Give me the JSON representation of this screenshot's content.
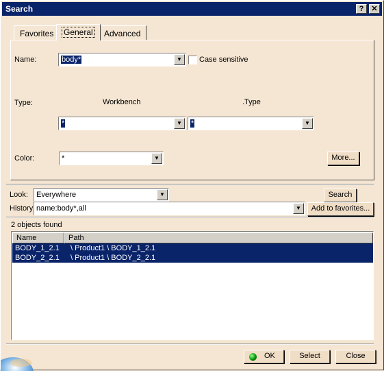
{
  "window": {
    "title": "Search"
  },
  "titlebar": {
    "help_label": "?",
    "close_label": "✕"
  },
  "tabs": [
    {
      "label": "Favorites"
    },
    {
      "label": "General"
    },
    {
      "label": "Advanced"
    }
  ],
  "general": {
    "name_label": "Name:",
    "name_value": "body*",
    "case_sensitive_label": "Case sensitive",
    "case_sensitive_checked": false,
    "type_label": "Type:",
    "workbench_label": "Workbench",
    "dottype_label": ".Type",
    "workbench_value": "*",
    "type_value": "*",
    "color_label": "Color:",
    "color_value": "*",
    "more_button": "More..."
  },
  "search": {
    "look_label": "Look:",
    "look_value": "Everywhere",
    "search_button": "Search",
    "history_label": "History:",
    "history_value": "name:body*,all",
    "add_favorites_button": "Add to favorites..."
  },
  "results": {
    "count_text": "2 objects found",
    "columns": [
      "Name",
      "Path"
    ],
    "rows": [
      {
        "name": "BODY_1_2.1",
        "path": "\\ Product1 \\ BODY_1_2.1"
      },
      {
        "name": "BODY_2_2.1",
        "path": "\\ Product1 \\ BODY_2_2.1"
      }
    ]
  },
  "footer": {
    "ok_button": "OK",
    "select_button": "Select",
    "close_button": "Close"
  },
  "colors": {
    "title_bar": "#0a246a",
    "dialog_bg": "#f5e6d3",
    "selection": "#0a246a",
    "ok_indicator": "#00a000"
  },
  "icons": {
    "help": "question-mark-icon",
    "close": "close-icon",
    "dropdown": "chevron-down-icon",
    "ok": "green-dot-icon",
    "brand": "globe-icon"
  }
}
